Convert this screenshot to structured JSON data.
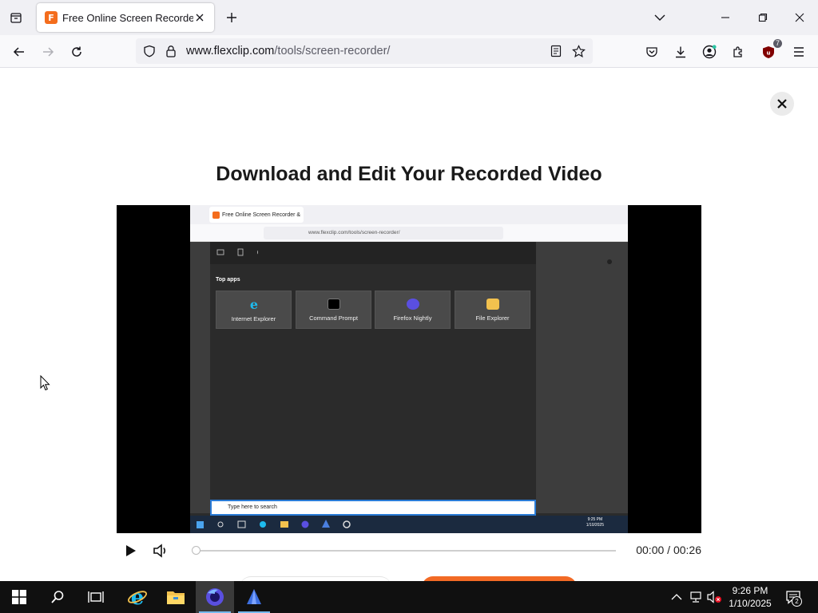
{
  "browser": {
    "tab": {
      "title": "Free Online Screen Recorder &",
      "favicon_letter": "F"
    },
    "url": {
      "domain": "www.flexclip.com",
      "path": "/tools/screen-recorder/"
    },
    "extensions_badge": "7"
  },
  "page": {
    "title": "Download and Edit Your Recorded Video",
    "player": {
      "time_current": "00:00",
      "time_separator": " / ",
      "time_total": "00:26",
      "progress": 0
    }
  },
  "recording_frame": {
    "tab_title": "Free Online Screen Recorder &",
    "url": "www.flexclip.com/tools/screen-recorder/",
    "section_label": "Top apps",
    "apps": [
      {
        "label": "Internet Explorer",
        "icon": "internet-explorer-icon"
      },
      {
        "label": "Command Prompt",
        "icon": "command-prompt-icon"
      },
      {
        "label": "Firefox Nightly",
        "icon": "firefox-nightly-icon"
      },
      {
        "label": "File Explorer",
        "icon": "file-explorer-icon"
      }
    ],
    "search_placeholder": "Type here to search",
    "tray_time": "9:25 PM",
    "tray_date": "1/10/2025"
  },
  "taskbar": {
    "time": "9:26 PM",
    "date": "1/10/2025",
    "notification_count": "2",
    "pinned": [
      "windows-start-icon",
      "search-icon",
      "task-view-icon",
      "internet-explorer-icon",
      "file-explorer-icon",
      "firefox-nightly-icon",
      "app-icon"
    ]
  },
  "colors": {
    "accent": "#f26a25",
    "taskbar_active": "#76b9ed",
    "frame_bg": "#2b2b2b"
  }
}
